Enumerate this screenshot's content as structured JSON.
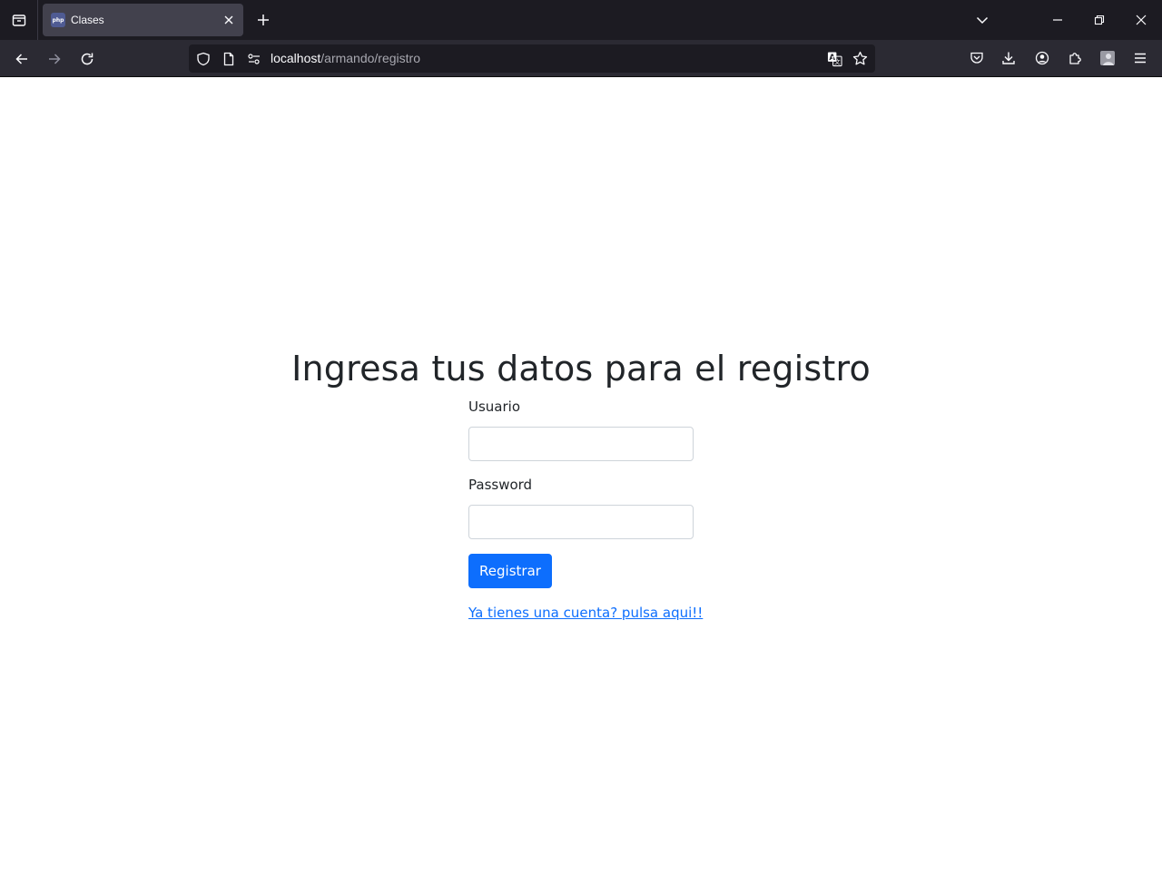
{
  "browser": {
    "tab": {
      "title": "Clases",
      "favicon_text": "php",
      "favicon_color": "#4f5b93"
    },
    "url": {
      "host": "localhost",
      "path": "/armando/registro"
    },
    "icons": {
      "tab_list": "tab-list-icon",
      "close_tab": "close-icon",
      "new_tab": "plus-icon",
      "list_all_tabs": "chevron-down-icon",
      "minimize": "minimize-icon",
      "restore": "restore-icon",
      "close_window": "close-icon",
      "back": "arrow-left-icon",
      "forward": "arrow-right-icon",
      "reload": "reload-icon",
      "shield": "shield-icon",
      "page": "page-icon",
      "permissions": "permissions-icon",
      "translate": "translate-icon",
      "bookmark": "star-icon",
      "pocket": "pocket-icon",
      "downloads": "download-icon",
      "account": "account-icon",
      "extensions": "puzzle-icon",
      "profile": "profile-icon",
      "menu": "hamburger-icon"
    }
  },
  "page": {
    "heading": "Ingresa tus datos para el registro",
    "form": {
      "username_label": "Usuario",
      "username_value": "",
      "password_label": "Password",
      "password_value": "",
      "submit_label": "Registrar"
    },
    "login_link": "Ya tienes una cuenta? pulsa aqui!!",
    "colors": {
      "primary": "#0d6efd",
      "text": "#212529",
      "input_border": "#ced4da"
    }
  }
}
